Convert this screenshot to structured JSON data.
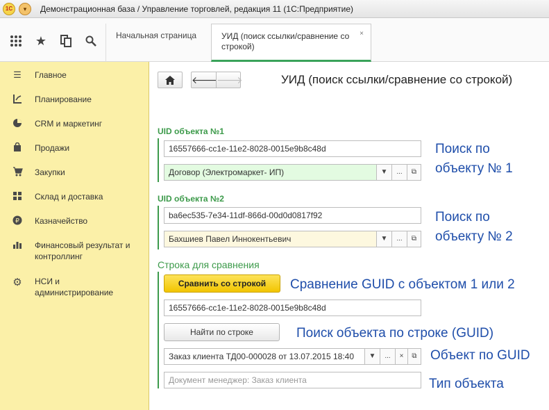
{
  "window": {
    "logo": "1С",
    "title": "Демонстрационная база / Управление торговлей, редакция 11  (1С:Предприятие)"
  },
  "tabs": [
    {
      "label": "Начальная страница"
    },
    {
      "label": "УИД (поиск ссылки/сравнение со строкой)",
      "close": "×"
    }
  ],
  "sidebar": {
    "items": [
      {
        "label": "Главное",
        "icon": "menu-icon"
      },
      {
        "label": "Планирование",
        "icon": "planning-icon"
      },
      {
        "label": "CRM и маркетинг",
        "icon": "pie-chart-icon"
      },
      {
        "label": "Продажи",
        "icon": "shopping-bag-icon"
      },
      {
        "label": "Закупки",
        "icon": "cart-icon"
      },
      {
        "label": "Склад и доставка",
        "icon": "warehouse-icon"
      },
      {
        "label": "Казначейство",
        "icon": "ruble-coin-icon"
      },
      {
        "label": "Финансовый результат и контроллинг",
        "icon": "bar-chart-icon"
      },
      {
        "label": "НСИ и администрирование",
        "icon": "gear-icon"
      }
    ]
  },
  "main": {
    "title": "УИД (поиск ссылки/сравнение со строкой)",
    "uid1": {
      "label": "UID объекта №1",
      "value": "16557666-cc1e-11e2-8028-0015e9b8c48d",
      "ref": "Договор (Электромаркет- ИП)"
    },
    "uid2": {
      "label": "UID объекта №2",
      "value": "ba6ec535-7e34-11df-866d-00d0d0817f92",
      "ref": "Бахшиев Павел Иннокентьевич"
    },
    "compare": {
      "label": "Строка для сравнения",
      "compare_button": "Сравнить со строкой",
      "value": "16557666-cc1e-11e2-8028-0015e9b8c48d",
      "find_button": "Найти по строке",
      "result": "Заказ клиента ТД00-000028 от 13.07.2015 18:40",
      "type_placeholder": "Документ менеджер: Заказ клиента"
    },
    "annotations": {
      "search1": "Поиск по\nобъекту № 1",
      "search2": "Поиск по\nобъекту № 2",
      "compare": "Сравнение GUID с объектом 1 или 2",
      "find": "Поиск объекта по строке (GUID)",
      "object": "Объект по GUID",
      "type": "Тип объекта"
    }
  },
  "colors": {
    "sidebar_bg": "#fbf0a8",
    "accent_green": "#3c9a4a",
    "primary_button": "#f2c500",
    "annotation_blue": "#1f4eaa"
  }
}
